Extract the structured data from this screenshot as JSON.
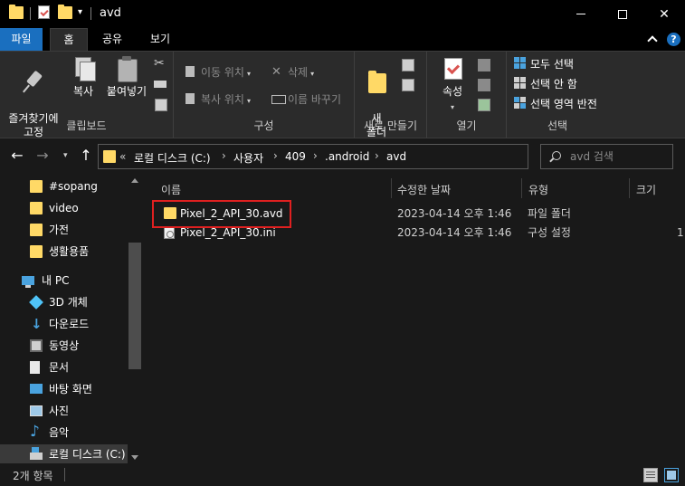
{
  "window": {
    "title": "avd"
  },
  "ribbon_tabs": {
    "file": "파일",
    "home": "홈",
    "share": "공유",
    "view": "보기"
  },
  "ribbon": {
    "clipboard": {
      "pin": "즐겨찾기에\n고정",
      "copy": "복사",
      "paste": "붙여넣기",
      "label": "클립보드"
    },
    "organize": {
      "move_to": "이동 위치",
      "copy_to": "복사 위치",
      "delete": "삭제",
      "rename": "이름 바꾸기",
      "label": "구성"
    },
    "new": {
      "new_folder": "새\n폴더",
      "label": "새로 만들기"
    },
    "open": {
      "properties": "속성",
      "label": "열기"
    },
    "select": {
      "select_all": "모두 선택",
      "select_none": "선택 안 함",
      "invert": "선택 영역 반전",
      "label": "선택"
    }
  },
  "address": {
    "overflow": "«",
    "crumbs": [
      "로컬 디스크 (C:)",
      "사용자",
      "409",
      ".android",
      "avd"
    ],
    "separator": "›"
  },
  "search": {
    "placeholder": "avd 검색"
  },
  "nav_pane": {
    "items": [
      {
        "label": "#sopang"
      },
      {
        "label": "video"
      },
      {
        "label": "가전"
      },
      {
        "label": "생활용품"
      },
      {
        "label": "내 PC"
      },
      {
        "label": "3D 개체"
      },
      {
        "label": "다운로드"
      },
      {
        "label": "동영상"
      },
      {
        "label": "문서"
      },
      {
        "label": "바탕 화면"
      },
      {
        "label": "사진"
      },
      {
        "label": "음악"
      },
      {
        "label": "로컬 디스크 (C:)"
      }
    ]
  },
  "file_list": {
    "columns": {
      "name": "이름",
      "modified": "수정한 날짜",
      "type": "유형",
      "size": "크기"
    },
    "rows": [
      {
        "name": "Pixel_2_API_30.avd",
        "modified": "2023-04-14 오후 1:46",
        "type": "파일 폴더",
        "size": ""
      },
      {
        "name": "Pixel_2_API_30.ini",
        "modified": "2023-04-14 오후 1:46",
        "type": "구성 설정",
        "size": "1"
      }
    ]
  },
  "status": {
    "item_count": "2개 항목"
  },
  "colors": {
    "accent": "#1a6fbf",
    "folder": "#ffd966",
    "highlight_box": "#e02020",
    "background": "#191919"
  }
}
